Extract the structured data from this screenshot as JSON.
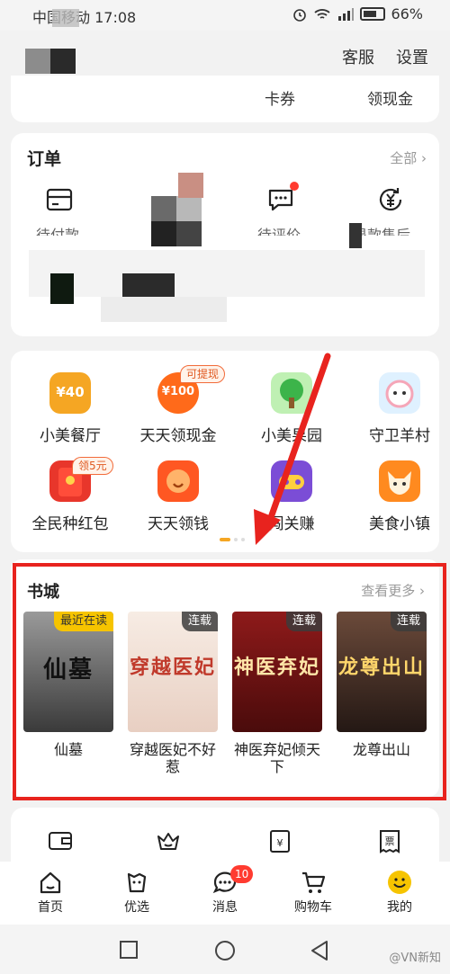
{
  "status_bar": {
    "carrier": "中国移动 17:08",
    "battery": "66%"
  },
  "header": {
    "service": "客服",
    "settings": "设置"
  },
  "wallet_row": {
    "coupons": "卡券",
    "cash": "领现金"
  },
  "orders": {
    "title": "订单",
    "all": "全部",
    "items": [
      {
        "label": "待付款",
        "icon": "card-icon"
      },
      {
        "label": "待评价",
        "icon": "chat-icon"
      },
      {
        "label": "退款售后",
        "icon": "refund-icon"
      }
    ]
  },
  "games": {
    "items": [
      {
        "label": "小美餐厅",
        "icon_text": "¥40",
        "color": "#f5a623"
      },
      {
        "label": "天天领现金",
        "icon_text": "¥100",
        "tag": "可提现",
        "color": "#ff6a1a"
      },
      {
        "label": "小美果园",
        "icon": "tree-icon",
        "color": "#4cc25a"
      },
      {
        "label": "守卫羊村",
        "icon": "sheep-icon",
        "color": "#ffb6c6"
      },
      {
        "label": "全民种红包",
        "icon": "redpacket-icon",
        "tag": "领5元",
        "color": "#e8362b"
      },
      {
        "label": "天天领钱",
        "icon": "coin-icon",
        "color": "#ff5722"
      },
      {
        "label": "闯关赚",
        "icon": "game-icon",
        "color": "#7b4dd6"
      },
      {
        "label": "美食小镇",
        "icon": "fox-icon",
        "color": "#ff8a1f"
      }
    ]
  },
  "books": {
    "title": "书城",
    "more": "查看更多",
    "items": [
      {
        "name": "仙墓",
        "badge": "最近在读",
        "cover_title": "仙墓",
        "bg": "#6d6d6d",
        "fg": "#1b1b1b"
      },
      {
        "name": "穿越医妃不好惹",
        "badge": "连载",
        "cover_title": "穿越医妃",
        "bg": "#f3e4da",
        "fg": "#c0392b"
      },
      {
        "name": "神医弃妃倾天下",
        "badge": "连载",
        "cover_title": "神医弃妃",
        "bg": "#7a1414",
        "fg": "#ffe6a8"
      },
      {
        "name": "龙尊出山",
        "badge": "连载",
        "cover_title": "龙尊出山",
        "bg": "#3b2a24",
        "fg": "#ffd66b"
      }
    ]
  },
  "tab_bar": {
    "items": [
      {
        "label": "首页",
        "icon": "home-icon"
      },
      {
        "label": "优选",
        "icon": "bag-icon"
      },
      {
        "label": "消息",
        "icon": "message-icon",
        "badge": "10"
      },
      {
        "label": "购物车",
        "icon": "cart-icon"
      },
      {
        "label": "我的",
        "icon": "smile-icon"
      }
    ]
  },
  "watermark": "@VN新知",
  "colors": {
    "accent": "#e8231e",
    "brand_yellow": "#f6c400"
  }
}
